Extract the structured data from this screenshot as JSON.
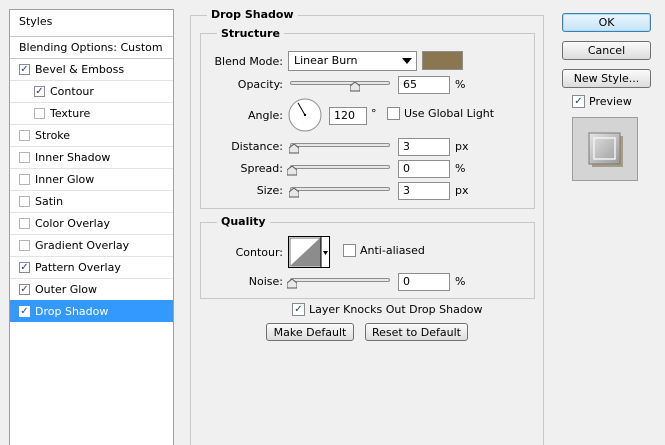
{
  "styles_panel": {
    "header": "Styles",
    "blending_options": "Blending Options: Custom",
    "items": [
      {
        "label": "Bevel & Emboss",
        "checked": true
      },
      {
        "label": "Contour",
        "checked": true,
        "sub": true
      },
      {
        "label": "Texture",
        "checked": false,
        "sub": true
      },
      {
        "label": "Stroke",
        "checked": false
      },
      {
        "label": "Inner Shadow",
        "checked": false
      },
      {
        "label": "Inner Glow",
        "checked": false
      },
      {
        "label": "Satin",
        "checked": false
      },
      {
        "label": "Color Overlay",
        "checked": false
      },
      {
        "label": "Gradient Overlay",
        "checked": false
      },
      {
        "label": "Pattern Overlay",
        "checked": true
      },
      {
        "label": "Outer Glow",
        "checked": true
      },
      {
        "label": "Drop Shadow",
        "checked": true,
        "selected": true
      }
    ]
  },
  "drop_shadow": {
    "title": "Drop Shadow",
    "structure": {
      "title": "Structure",
      "blend_mode_label": "Blend Mode:",
      "blend_mode_value": "Linear Burn",
      "shadow_color": "#8a7650",
      "opacity_label": "Opacity:",
      "opacity_value": "65",
      "opacity_unit": "%",
      "opacity_fraction": 0.65,
      "angle_label": "Angle:",
      "angle_value": "120",
      "angle_unit": "°",
      "use_global_light_label": "Use Global Light",
      "use_global_light_checked": false,
      "distance_label": "Distance:",
      "distance_value": "3",
      "distance_unit": "px",
      "spread_label": "Spread:",
      "spread_value": "0",
      "spread_unit": "%",
      "size_label": "Size:",
      "size_value": "3",
      "size_unit": "px"
    },
    "quality": {
      "title": "Quality",
      "contour_label": "Contour:",
      "anti_aliased_label": "Anti-aliased",
      "anti_aliased_checked": false,
      "noise_label": "Noise:",
      "noise_value": "0",
      "noise_unit": "%"
    },
    "layer_knocks_out_label": "Layer Knocks Out Drop Shadow",
    "layer_knocks_out_checked": true,
    "make_default_label": "Make Default",
    "reset_default_label": "Reset to Default"
  },
  "buttons": {
    "ok": "OK",
    "cancel": "Cancel",
    "new_style": "New Style...",
    "preview_label": "Preview",
    "preview_checked": true
  }
}
